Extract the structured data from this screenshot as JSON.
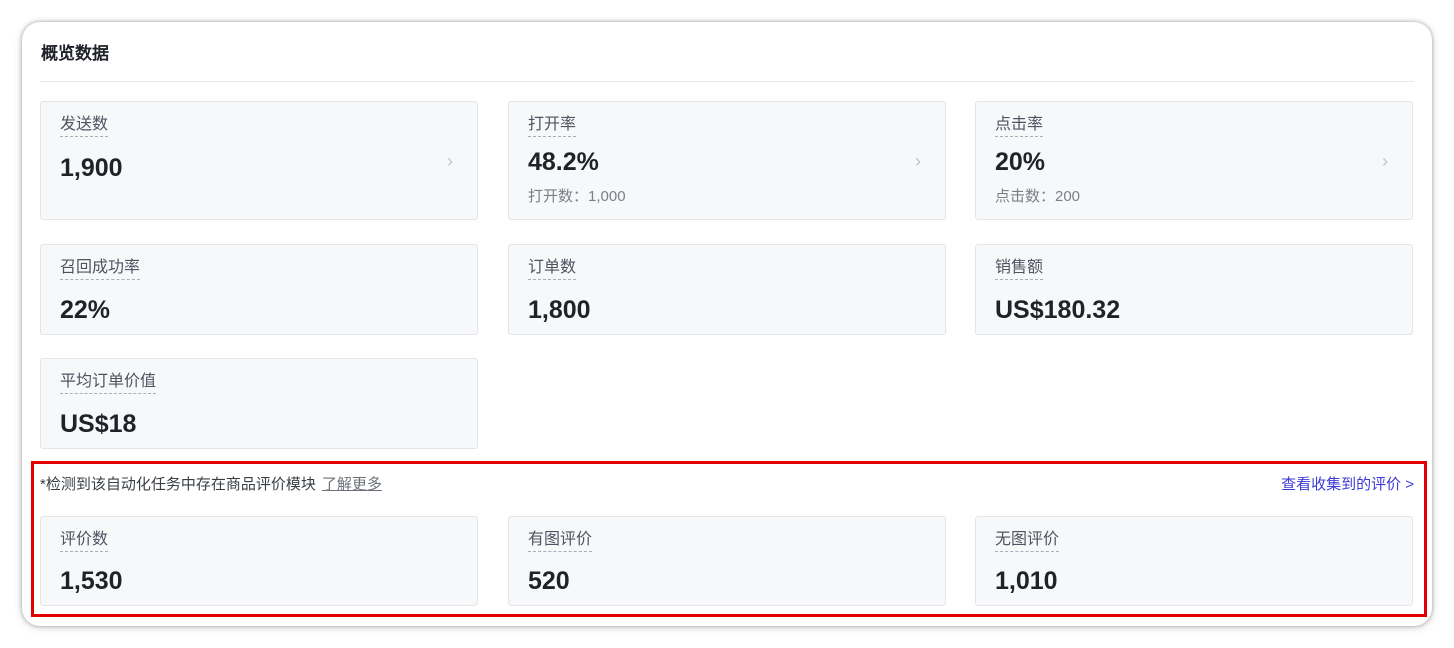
{
  "panel": {
    "title": "概览数据"
  },
  "metrics": [
    {
      "label": "发送数",
      "value": "1,900",
      "sub": "",
      "arrow": "›"
    },
    {
      "label": "打开率",
      "value": "48.2%",
      "sub": "打开数：1,000",
      "arrow": "›"
    },
    {
      "label": "点击率",
      "value": "20%",
      "sub": "点击数：200",
      "arrow": "›"
    },
    {
      "label": "召回成功率",
      "value": "22%"
    },
    {
      "label": "订单数",
      "value": "1,800"
    },
    {
      "label": "销售额",
      "value": "US$180.32"
    },
    {
      "label": "平均订单价值",
      "value": "US$18"
    }
  ],
  "review_section": {
    "notice": "*检测到该自动化任务中存在商品评价模块",
    "learn_more": "了解更多",
    "view_link": "查看收集到的评价 >",
    "link_color": "#3d3bd8",
    "highlight_color": "#e00000",
    "metrics": [
      {
        "label": "评价数",
        "value": "1,530"
      },
      {
        "label": "有图评价",
        "value": "520"
      },
      {
        "label": "无图评价",
        "value": "1,010"
      }
    ]
  }
}
